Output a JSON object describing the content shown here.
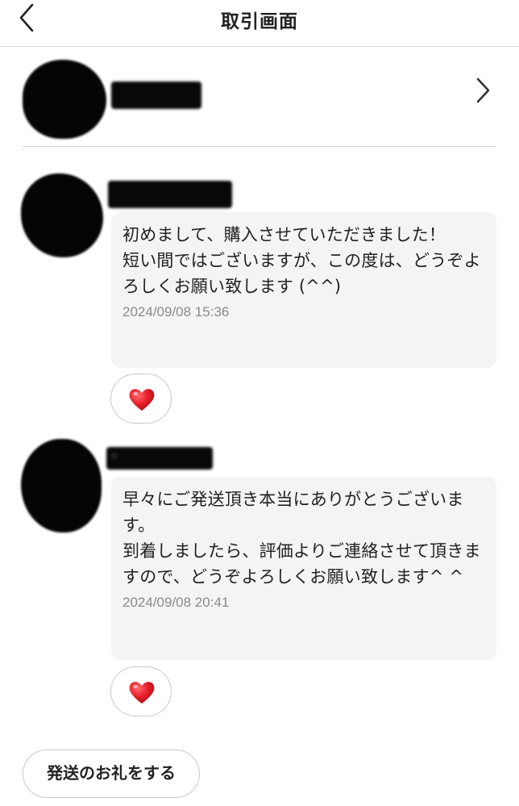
{
  "header": {
    "title": "取引画面",
    "back_icon": "chevron-left-icon"
  },
  "partner": {
    "name_redacted": "",
    "chevron_icon": "chevron-right-icon"
  },
  "messages": [
    {
      "name_redacted": "",
      "text": "初めまして、購入させていただきました！\n短い間ではございますが、この度は、どうぞよろしくお願い致します (^^)",
      "time": "2024/09/08 15:36",
      "like_icon": "heart-icon"
    },
    {
      "name_redacted": "n",
      "text": "早々にご発送頂き本当にありがとうございます。\n到着しましたら、評価よりご連絡させて頂きますので、どうぞよろしくお願い致します^ ^",
      "time": "2024/09/08 20:41",
      "like_icon": "heart-icon"
    }
  ],
  "actions": {
    "thanks_button": "発送のお礼をする"
  },
  "colors": {
    "heart": "#e8202a",
    "bubble_bg": "#f4f4f4",
    "timestamp": "#8a8a8a"
  }
}
